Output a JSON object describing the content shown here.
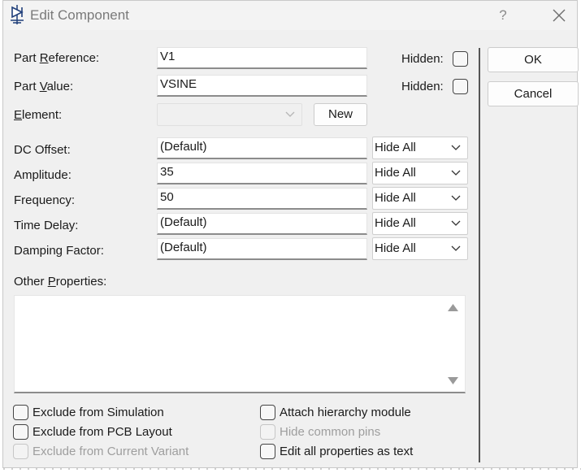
{
  "window": {
    "title": "Edit Component",
    "help": "?"
  },
  "part_reference": {
    "label_pre": "Part ",
    "label_u": "R",
    "label_post": "eference:",
    "value": "V1",
    "hidden_label": "Hidden:",
    "hidden_checked": false
  },
  "part_value": {
    "label_pre": "Part ",
    "label_u": "V",
    "label_post": "alue:",
    "value": "VSINE",
    "hidden_label": "Hidden:",
    "hidden_checked": false
  },
  "element": {
    "label_u": "E",
    "label_post": "lement:",
    "value": "",
    "new_button": "New"
  },
  "properties": [
    {
      "label": "DC Offset:",
      "value": "(Default)",
      "visibility": "Hide All"
    },
    {
      "label": "Amplitude:",
      "value": "35",
      "visibility": "Hide All"
    },
    {
      "label": "Frequency:",
      "value": "50",
      "visibility": "Hide All"
    },
    {
      "label": "Time Delay:",
      "value": "(Default)",
      "visibility": "Hide All"
    },
    {
      "label": "Damping Factor:",
      "value": "(Default)",
      "visibility": "Hide All"
    }
  ],
  "other_properties": {
    "label_pre": "Other ",
    "label_u": "P",
    "label_post": "roperties:",
    "value": ""
  },
  "options_left": [
    {
      "label": "Exclude from Simulation",
      "checked": false,
      "enabled": true
    },
    {
      "label": "Exclude from PCB Layout",
      "checked": false,
      "enabled": true
    },
    {
      "label": "Exclude from Current Variant",
      "checked": false,
      "enabled": false
    }
  ],
  "options_right": [
    {
      "label": "Attach hierarchy module",
      "checked": false,
      "enabled": true
    },
    {
      "label": "Hide common pins",
      "checked": false,
      "enabled": false
    },
    {
      "label": "Edit all properties as text",
      "checked": false,
      "enabled": true
    }
  ],
  "buttons": {
    "ok": "OK",
    "cancel": "Cancel"
  }
}
